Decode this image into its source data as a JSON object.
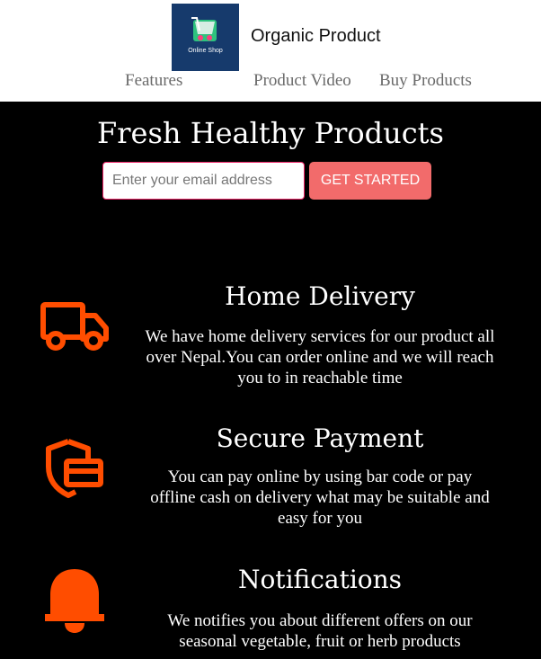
{
  "header": {
    "brand": "Organic Product",
    "logo": {
      "text": "Online Shop"
    },
    "nav": [
      "Features",
      "Product Video",
      "Buy Products"
    ]
  },
  "hero": {
    "title": "Fresh Healthy Products",
    "email_placeholder": "Enter your email address",
    "cta_label": "GET STARTED"
  },
  "features": [
    {
      "icon": "truck-icon",
      "title": "Home Delivery",
      "text": "We have home delivery services for our product all over Nepal.You can order online and we will reach you to in reachable time"
    },
    {
      "icon": "secure-card-icon",
      "title": "Secure Payment",
      "text": "You can pay online by using bar code or pay offline cash on delivery what may be suitable and easy for you"
    },
    {
      "icon": "bell-icon",
      "title": "Notifications",
      "text": "We notifies you about different offers on our seasonal vegetable, fruit or herb products"
    }
  ],
  "colors": {
    "background": "#000000",
    "accent": "#ff4d00",
    "cta": "#f26b6b",
    "nav_text": "#6a6a6a"
  }
}
